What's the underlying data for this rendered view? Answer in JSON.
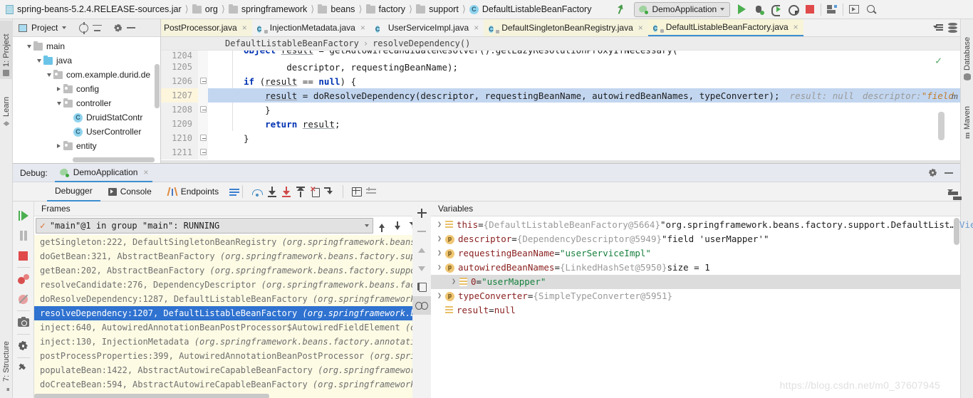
{
  "topbar": {
    "breadcrumbs": [
      {
        "label": "spring-beans-5.2.4.RELEASE-sources.jar",
        "icon": "jar-icon"
      },
      {
        "label": "org",
        "icon": "folder-icon"
      },
      {
        "label": "springframework",
        "icon": "folder-icon"
      },
      {
        "label": "beans",
        "icon": "folder-icon"
      },
      {
        "label": "factory",
        "icon": "folder-icon"
      },
      {
        "label": "support",
        "icon": "folder-icon"
      },
      {
        "label": "DefaultListableBeanFactory",
        "icon": "class-icon"
      }
    ],
    "run_config": "DemoApplication",
    "buttons": {
      "run": "Run",
      "debug": "Debug",
      "run_coverage": "Run with Coverage",
      "profile": "Profiler",
      "stop": "Stop",
      "layout": "Layout",
      "screen": "Screen",
      "search": "Search Everywhere"
    }
  },
  "left_strip": {
    "project": "1: Project",
    "learn": "Learn",
    "structure": "7: Structure"
  },
  "right_strip": {
    "database": "Database",
    "maven": "Maven",
    "maven_glyph": "m"
  },
  "project_pane": {
    "title": "Project",
    "tree": [
      {
        "label": "main",
        "depth": 0,
        "twist": "down",
        "icon": "folder-icon"
      },
      {
        "label": "java",
        "depth": 1,
        "twist": "down",
        "icon": "source-folder-icon"
      },
      {
        "label": "com.example.durid.de",
        "depth": 2,
        "twist": "down",
        "icon": "package-icon"
      },
      {
        "label": "config",
        "depth": 3,
        "twist": "right",
        "icon": "package-icon"
      },
      {
        "label": "controller",
        "depth": 3,
        "twist": "down",
        "icon": "package-icon"
      },
      {
        "label": "DruidStatContr",
        "depth": 4,
        "twist": "none",
        "icon": "class-icon"
      },
      {
        "label": "UserController",
        "depth": 4,
        "twist": "none",
        "icon": "class-icon"
      },
      {
        "label": "entity",
        "depth": 3,
        "twist": "right",
        "icon": "package-icon"
      }
    ]
  },
  "editor": {
    "tabs": [
      {
        "label": "PostProcessor.java",
        "state": "modified",
        "icon": "class-icon"
      },
      {
        "label": "InjectionMetadata.java",
        "state": "normal",
        "icon": "class-locked-icon"
      },
      {
        "label": "UserServiceImpl.java",
        "state": "normal",
        "icon": "class-icon"
      },
      {
        "label": "DefaultSingletonBeanRegistry.java",
        "state": "modified",
        "icon": "class-locked-icon"
      },
      {
        "label": "DefaultListableBeanFactory.java",
        "state": "active",
        "icon": "class-locked-icon"
      }
    ],
    "close_glyph": "×",
    "breadcrumb": {
      "class": "DefaultListableBeanFactory",
      "separator": "›",
      "method": "resolveDependency()"
    },
    "lines": [
      {
        "num": "1204",
        "text": "Object result = getAutowireCandidateResolver().getLazyResolutionProxyIfNecessary(",
        "clipped": true
      },
      {
        "num": "1205",
        "text": "        descriptor, requestingBeanName);"
      },
      {
        "num": "1206",
        "text": "if (result == null) {"
      },
      {
        "num": "1207",
        "text": "    result = doResolveDependency(descriptor, requestingBeanName, autowiredBeanNames, typeConverter);",
        "current": true,
        "inline_hint_1": "result: null",
        "inline_hint_2": "descriptor: ",
        "inline_hint_3": "\"field"
      },
      {
        "num": "1208",
        "text": "}"
      },
      {
        "num": "1209",
        "text": "return result;"
      },
      {
        "num": "1210",
        "text": "}"
      },
      {
        "num": "1211",
        "text": "}"
      }
    ],
    "minimap_letter": "m"
  },
  "debug": {
    "header": {
      "label": "Debug:",
      "tab": "DemoApplication",
      "close_glyph": "×"
    },
    "toolbar_tabs": [
      {
        "label": "Debugger",
        "selected": true,
        "icon": "debugger-icon"
      },
      {
        "label": "Console",
        "selected": false,
        "icon": "console-icon"
      },
      {
        "label": "Endpoints",
        "selected": false,
        "icon": "endpoints-icon"
      }
    ],
    "step_buttons": [
      "step-over",
      "step-into",
      "force-step-into",
      "step-out",
      "drop-frame",
      "run-to-cursor"
    ],
    "extra_buttons": [
      "evaluate-expression",
      "settings"
    ],
    "side_buttons": [
      "resume-program",
      "pause-program",
      "stop",
      "view-breakpoints",
      "mute-breakpoints",
      "take-snapshot",
      "settings",
      "pin-tab"
    ],
    "frames": {
      "title": "Frames",
      "thread": "\"main\"@1 in group \"main\": RUNNING",
      "items": [
        {
          "call": "getSingleton:222, DefaultSingletonBeanRegistry ",
          "pkg": "(org.springframework.beans",
          "selected": false
        },
        {
          "call": "doGetBean:321, AbstractBeanFactory ",
          "pkg": "(org.springframework.beans.factory.sup",
          "selected": false
        },
        {
          "call": "getBean:202, AbstractBeanFactory ",
          "pkg": "(org.springframework.beans.factory.suppo",
          "selected": false
        },
        {
          "call": "resolveCandidate:276, DependencyDescriptor ",
          "pkg": "(org.springframework.beans.fac",
          "selected": false
        },
        {
          "call": "doResolveDependency:1287, DefaultListableBeanFactory ",
          "pkg": "(org.springframework",
          "selected": false
        },
        {
          "call": "resolveDependency:1207, DefaultListableBeanFactory ",
          "pkg": "(org.springframework.b",
          "selected": true
        },
        {
          "call": "inject:640, AutowiredAnnotationBeanPostProcessor$AutowiredFieldElement ",
          "pkg": "(o",
          "selected": false
        },
        {
          "call": "inject:130, InjectionMetadata ",
          "pkg": "(org.springframework.beans.factory.annotati",
          "selected": false
        },
        {
          "call": "postProcessProperties:399, AutowiredAnnotationBeanPostProcessor ",
          "pkg": "(org.spri",
          "selected": false
        },
        {
          "call": "populateBean:1422, AbstractAutowireCapableBeanFactory ",
          "pkg": "(org.springframewor",
          "selected": false
        },
        {
          "call": "doCreateBean:594, AbstractAutowireCapableBeanFactory ",
          "pkg": "(org.springframework",
          "selected": false
        }
      ]
    },
    "variables": {
      "title": "Variables",
      "rows": [
        {
          "twist": "right",
          "icon": "field-icon",
          "name": "this",
          "eq": " = ",
          "ref": "{DefaultListableBeanFactory@5664}",
          "value": " \"org.springframework.beans.factory.support.DefaultList…",
          "value_kind": "string-plain",
          "link": "View",
          "indent": 0,
          "highlight": false
        },
        {
          "twist": "right",
          "icon": "param-icon",
          "name": "descriptor",
          "eq": " = ",
          "ref": "{DependencyDescriptor@5949}",
          "value": " \"field 'userMapper'\"",
          "value_kind": "string-plain",
          "indent": 0,
          "highlight": false
        },
        {
          "twist": "right",
          "icon": "param-icon",
          "name": "requestingBeanName",
          "eq": " = ",
          "ref": "",
          "value": "\"userServiceImpl\"",
          "value_kind": "string",
          "indent": 0,
          "highlight": false
        },
        {
          "twist": "down",
          "icon": "param-icon",
          "name": "autowiredBeanNames",
          "eq": " = ",
          "ref": "{LinkedHashSet@5950}",
          "value": "  size = 1",
          "value_kind": "plain",
          "indent": 0,
          "highlight": false
        },
        {
          "twist": "right",
          "icon": "field-icon",
          "name": "0",
          "eq": " = ",
          "ref": "",
          "value": "\"userMapper\"",
          "value_kind": "string",
          "indent": 1,
          "highlight": true
        },
        {
          "twist": "right",
          "icon": "param-icon",
          "name": "typeConverter",
          "eq": " = ",
          "ref": "{SimpleTypeConverter@5951}",
          "value": "",
          "value_kind": "plain",
          "indent": 0,
          "highlight": false
        },
        {
          "twist": "none",
          "icon": "field-icon",
          "name": "result",
          "eq": " = ",
          "ref": "",
          "value": "null",
          "value_kind": "null",
          "indent": 0,
          "highlight": false
        }
      ],
      "param_glyph": "p"
    }
  },
  "watermark": "https://blog.csdn.net/m0_37607945",
  "colors": {
    "accent": "#3c8fd0",
    "selection": "#2f72d0",
    "current_line": "#c2d6f0",
    "modified_tab": "#f5f3dc",
    "frames_bg": "#fdfbe4",
    "string": "#17803d",
    "keyword": "#0033b3"
  }
}
